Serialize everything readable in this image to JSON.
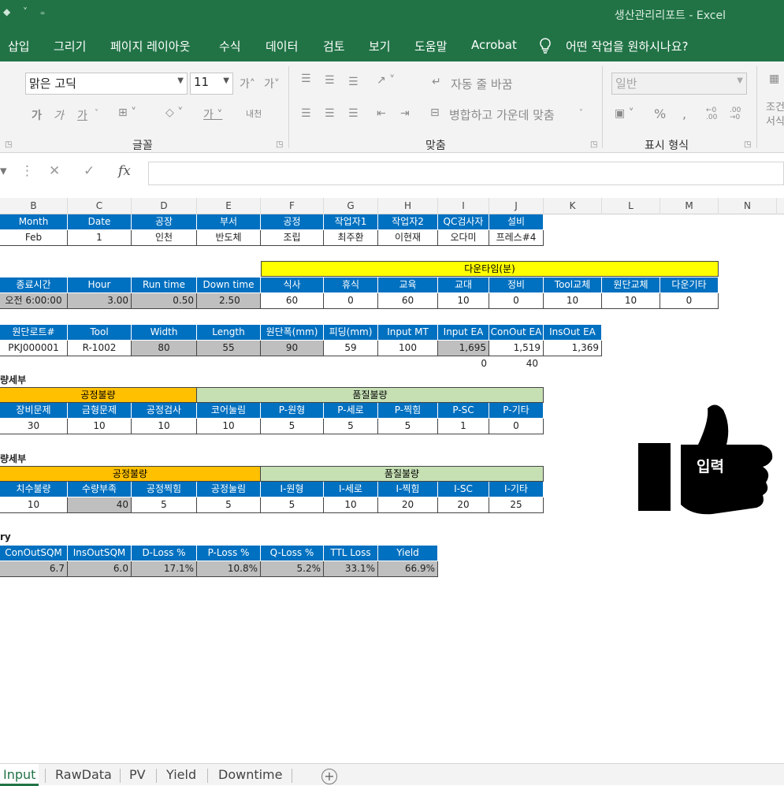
{
  "title": {
    "quick_access": "◆ ˅ ₌",
    "title_text": "생산관리리포트 - Excel"
  },
  "menu": {
    "tabs": [
      "삽입",
      "그리기",
      "페이지 레이아웃",
      "수식",
      "데이터",
      "검토",
      "보기",
      "도움말",
      "Acrobat"
    ],
    "tellme_icon": "lightbulb-icon",
    "tellme": "어떤 작업을 원하시나요?"
  },
  "ribbon": {
    "font_name": "맑은 고딕",
    "font_size": "11",
    "grow_font": "가˄",
    "shrink_font": "가˅",
    "bold": "가",
    "italic": "가",
    "underline": "가",
    "phonetic": "내천",
    "wrap_text": "자동 줄 바꿈",
    "merge_center": "병합하고 가운데 맞춤",
    "number_format": "일반",
    "percent": "%",
    "comma": ",",
    "inc_decimal": "←0 .00",
    "dec_decimal": ".00 →0",
    "conditional_format": "조건\n서식",
    "groups": {
      "font": "글꼴",
      "alignment": "맞춤",
      "number": "표시 형식"
    }
  },
  "formula_bar": {
    "cancel": "✕",
    "enter": "✓",
    "fx": "fx",
    "value": ""
  },
  "columns": [
    "B",
    "C",
    "D",
    "E",
    "F",
    "G",
    "H",
    "I",
    "J",
    "K",
    "L",
    "M",
    "N"
  ],
  "table1": {
    "headers": [
      "Month",
      "Date",
      "공장",
      "부서",
      "공정",
      "작업자1",
      "작업자2",
      "QC검사자",
      "설비"
    ],
    "row": [
      "Feb",
      "1",
      "인천",
      "반도체",
      "조립",
      "최주환",
      "이현재",
      "오다미",
      "프레스#4"
    ]
  },
  "table2": {
    "group_header": "다운타임(분)",
    "headers": [
      "종료시간",
      "Hour",
      "Run time",
      "Down time",
      "식사",
      "휴식",
      "교육",
      "교대",
      "정비",
      "Tool교체",
      "원단교체",
      "다운기타"
    ],
    "row": [
      "오전 6:00:00",
      "3.00",
      "0.50",
      "2.50",
      "60",
      "0",
      "60",
      "10",
      "0",
      "10",
      "10",
      "0"
    ]
  },
  "table3": {
    "headers": [
      "원단로트#",
      "Tool",
      "Width",
      "Length",
      "원단폭(mm)",
      "피딩(mm)",
      "Input MT",
      "Input EA",
      "ConOut EA",
      "InsOut EA"
    ],
    "row": [
      "PKJ000001",
      "R-1002",
      "80",
      "55",
      "90",
      "59",
      "100",
      "1,695",
      "1,519",
      "1,369"
    ],
    "extra": [
      "0",
      "40"
    ]
  },
  "section1": {
    "title": "량세부",
    "group_process": "공정불량",
    "group_quality": "품질불량",
    "headers": [
      "장비문제",
      "금형문제",
      "공정검사",
      "코어눌림",
      "P-원형",
      "P-세로",
      "P-찍힘",
      "P-SC",
      "P-기타"
    ],
    "row": [
      "30",
      "10",
      "10",
      "10",
      "5",
      "5",
      "5",
      "1",
      "0"
    ]
  },
  "section2": {
    "title": "량세부",
    "group_process": "공정불량",
    "group_quality": "품질불량",
    "headers": [
      "치수불량",
      "수량부족",
      "공정찍힘",
      "공정눌림",
      "I-원형",
      "I-세로",
      "I-찍힘",
      "I-SC",
      "I-기타"
    ],
    "row": [
      "10",
      "40",
      "5",
      "5",
      "5",
      "10",
      "20",
      "20",
      "25"
    ]
  },
  "summary": {
    "title": "ry",
    "headers": [
      "ConOutSQM",
      "InsOutSQM",
      "D-Loss %",
      "P-Loss %",
      "Q-Loss %",
      "TTL Loss",
      "Yield"
    ],
    "row": [
      "6.7",
      "6.0",
      "17.1%",
      "10.8%",
      "5.2%",
      "33.1%",
      "66.9%"
    ]
  },
  "badge": {
    "icon": "thumbs-up-icon",
    "label": "입력",
    "color": "#000000"
  },
  "sheet_tabs": [
    "Input",
    "RawData",
    "PV",
    "Yield",
    "Downtime"
  ],
  "add_sheet": "+",
  "colors": {
    "excel_green": "#217346",
    "header_blue": "#0070c0",
    "yellow": "#ffff00",
    "orange": "#ffc000",
    "green_light": "#c6e0b4",
    "gray": "#bfbfbf"
  }
}
